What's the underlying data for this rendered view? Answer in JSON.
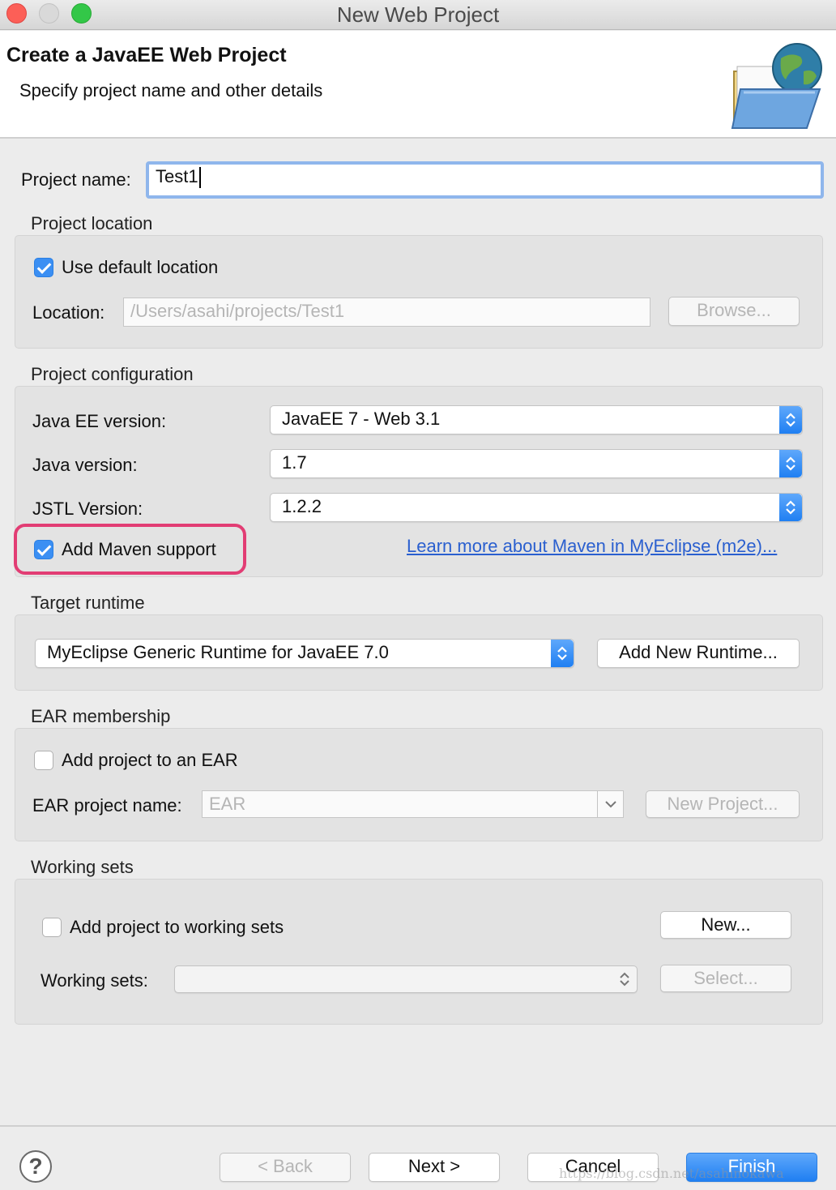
{
  "window": {
    "title": "New Web Project"
  },
  "header": {
    "title": "Create a JavaEE Web Project",
    "subtitle": "Specify project name and other details"
  },
  "project_name": {
    "label": "Project name:",
    "value": "Test1"
  },
  "project_location": {
    "group_title": "Project location",
    "use_default_label": "Use default location",
    "use_default_checked": true,
    "location_label": "Location:",
    "location_value": "/Users/asahi/projects/Test1",
    "browse_label": "Browse..."
  },
  "project_configuration": {
    "group_title": "Project configuration",
    "javaee_label": "Java EE version:",
    "javaee_value": "JavaEE 7 - Web 3.1",
    "java_label": "Java version:",
    "java_value": "1.7",
    "jstl_label": "JSTL Version:",
    "jstl_value": "1.2.2",
    "maven_label": "Add Maven support",
    "maven_checked": true,
    "maven_link": "Learn more about Maven in MyEclipse (m2e)..."
  },
  "target_runtime": {
    "group_title": "Target runtime",
    "runtime_value": "MyEclipse Generic Runtime for JavaEE 7.0",
    "add_runtime_label": "Add New Runtime..."
  },
  "ear_membership": {
    "group_title": "EAR membership",
    "add_to_ear_label": "Add project to an EAR",
    "add_to_ear_checked": false,
    "ear_name_label": "EAR project name:",
    "ear_name_value": "EAR",
    "new_project_label": "New Project..."
  },
  "working_sets": {
    "group_title": "Working sets",
    "add_to_sets_label": "Add project to working sets",
    "add_to_sets_checked": false,
    "new_label": "New...",
    "sets_label": "Working sets:",
    "select_label": "Select..."
  },
  "footer": {
    "help_glyph": "?",
    "back_label": "< Back",
    "next_label": "Next >",
    "cancel_label": "Cancel",
    "finish_label": "Finish",
    "watermark": "https://blog.csdn.net/asahinokawa"
  },
  "colors": {
    "accent": "#1f7ff2",
    "highlight": "#e23d74",
    "link": "#2a5fcf"
  }
}
